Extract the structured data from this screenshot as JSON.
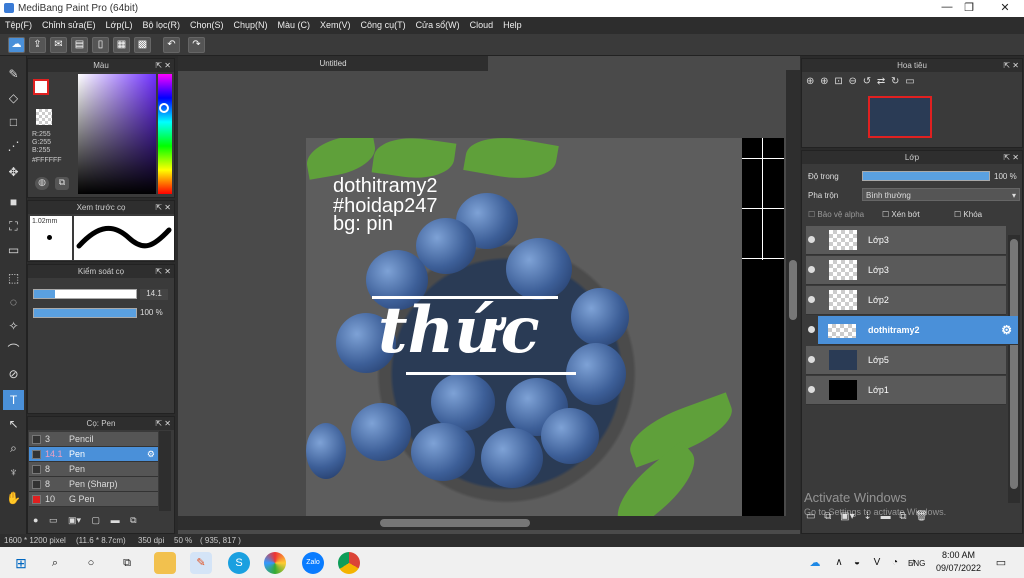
{
  "window": {
    "title": "MediBang Paint Pro (64bit)",
    "min": "—",
    "max": "❐",
    "close": "✕"
  },
  "menu": [
    "Tệp(F)",
    "Chỉnh sửa(E)",
    "Lớp(L)",
    "Bộ lọc(R)",
    "Chọn(S)",
    "Chụp(N)",
    "Màu (C)",
    "Xem(V)",
    "Công cụ(T)",
    "Cửa sổ(W)",
    "Cloud",
    "Help"
  ],
  "color_panel": {
    "title": "Màu",
    "r": "R:255",
    "g": "G:255",
    "b": "B:255",
    "hex": "#FFFFFF"
  },
  "brush_preview": {
    "title": "Xem trước cọ",
    "size": "1.02mm"
  },
  "brush_control": {
    "title": "Kiểm soát cọ",
    "size": "14.1",
    "opacity": "100 %",
    "size_level": 0.21,
    "opacity_level": 1.0
  },
  "brush_list": {
    "title": "Cọ: Pen",
    "items": [
      {
        "num": "3",
        "name": "Pencil",
        "color": "#333333"
      },
      {
        "num": "14.1",
        "name": "Pen",
        "color": "#333333",
        "selected": true
      },
      {
        "num": "8",
        "name": "Pen",
        "color": "#333333"
      },
      {
        "num": "8",
        "name": "Pen (Sharp)",
        "color": "#333333"
      },
      {
        "num": "10",
        "name": "G Pen",
        "color": "#e02020"
      }
    ]
  },
  "document": {
    "tab": "Untitled"
  },
  "artwork": {
    "line1": "dothitramy2",
    "line2": "#hoidap247",
    "line3": "bg: pin",
    "logo": "thức"
  },
  "navigator": {
    "title": "Hoa tiêu"
  },
  "layers_panel": {
    "title": "Lớp",
    "opacity_label": "Độ trong",
    "opacity_value": "100 %",
    "blend_label": "Pha trộn",
    "blend_value": "Bình thường",
    "protect_alpha": "Bảo vệ alpha",
    "clipping": "Xén bớt",
    "lock": "Khóa",
    "layers": [
      {
        "name": "Lớp3"
      },
      {
        "name": "Lớp3"
      },
      {
        "name": "Lớp2"
      },
      {
        "name": "dothitramy2",
        "selected": true
      },
      {
        "name": "Lớp5"
      },
      {
        "name": "Lớp1"
      }
    ]
  },
  "watermark": {
    "line1": "Activate Windows",
    "line2": "Go to Settings to activate Windows."
  },
  "status": {
    "size": "1600 * 1200 pixel",
    "phys": "(11.6 * 8.7cm)",
    "dpi": "350 dpi",
    "zoom": "50 %",
    "coords": "( 935, 817 )"
  },
  "taskbar": {
    "lang": "ENG",
    "time": "8:00 AM",
    "date": "09/07/2022"
  },
  "colors": {
    "accent": "#4a90d9",
    "panel": "#3a3a3a",
    "bg": "#2b2b2b"
  }
}
